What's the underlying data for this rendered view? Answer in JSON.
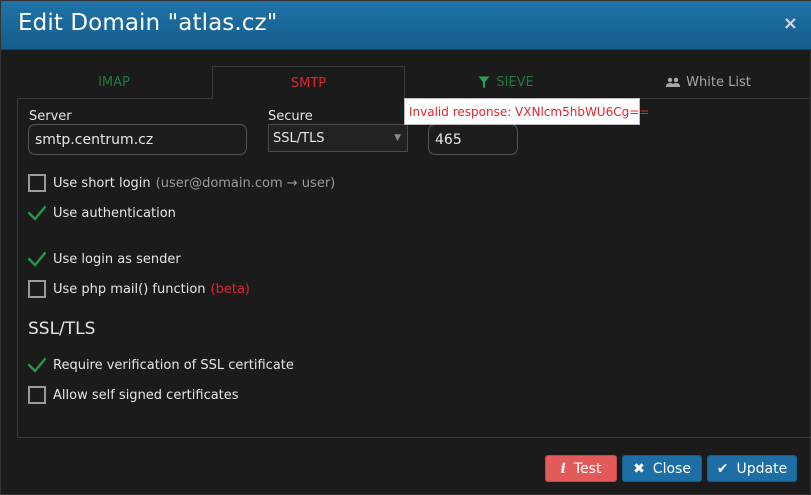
{
  "dialog": {
    "title": "Edit Domain \"atlas.cz\"",
    "close_glyph": "×"
  },
  "tabs": [
    {
      "label": "IMAP",
      "state": "inactive"
    },
    {
      "label": "SMTP",
      "state": "active"
    },
    {
      "label": "SIEVE",
      "state": "inactive",
      "icon": "filter-icon"
    },
    {
      "label": "White List",
      "state": "inactive",
      "icon": "users-icon"
    }
  ],
  "smtp": {
    "server_label": "Server",
    "server_value": "smtp.centrum.cz",
    "secure_label": "Secure",
    "secure_value": "SSL/TLS",
    "port_value": "465",
    "tooltip": "Invalid response: VXNlcm5hbWU6Cg=="
  },
  "options": {
    "short_login": {
      "label": "Use short login",
      "hint": "(user@domain.com → user)",
      "checked": false
    },
    "authentication": {
      "label": "Use authentication",
      "checked": true
    },
    "login_as_sender": {
      "label": "Use login as sender",
      "checked": true
    },
    "php_mail": {
      "label": "Use php mail() function",
      "hint": "(beta)",
      "checked": false
    }
  },
  "ssl": {
    "title": "SSL/TLS",
    "verify": {
      "label": "Require verification of SSL certificate",
      "checked": true
    },
    "self_signed": {
      "label": "Allow self signed certificates",
      "checked": false
    }
  },
  "footer": {
    "test_label": "Test",
    "close_label": "Close",
    "update_label": "Update"
  },
  "colors": {
    "header": "#1c6ea4",
    "active_tab": "#e0242f",
    "inactive_tab": "#1f7a3c",
    "check": "#1f9a4a",
    "test_button": "#e35a5a"
  }
}
